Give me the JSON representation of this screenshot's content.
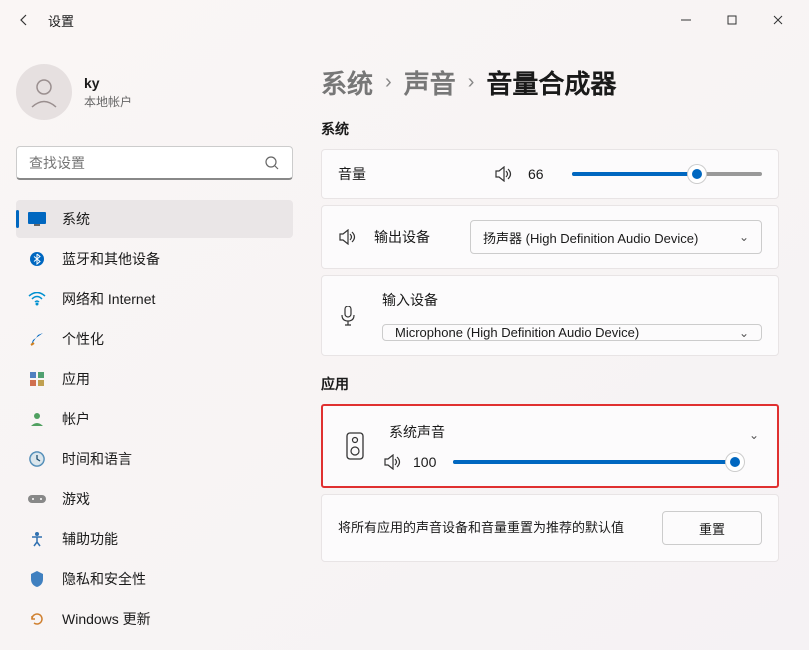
{
  "window": {
    "title": "设置"
  },
  "user": {
    "name": "ky",
    "subtitle": "本地帐户"
  },
  "search": {
    "placeholder": "查找设置"
  },
  "nav": {
    "items": [
      {
        "label": "系统",
        "active": true
      },
      {
        "label": "蓝牙和其他设备",
        "active": false
      },
      {
        "label": "网络和 Internet",
        "active": false
      },
      {
        "label": "个性化",
        "active": false
      },
      {
        "label": "应用",
        "active": false
      },
      {
        "label": "帐户",
        "active": false
      },
      {
        "label": "时间和语言",
        "active": false
      },
      {
        "label": "游戏",
        "active": false
      },
      {
        "label": "辅助功能",
        "active": false
      },
      {
        "label": "隐私和安全性",
        "active": false
      },
      {
        "label": "Windows 更新",
        "active": false
      }
    ]
  },
  "breadcrumb": {
    "system": "系统",
    "sound": "声音",
    "mixer": "音量合成器"
  },
  "system_section": {
    "label": "系统",
    "volume": {
      "label": "音量",
      "value": "66",
      "percent": 66
    },
    "output": {
      "label": "输出设备",
      "selected": "扬声器 (High Definition Audio Device)"
    },
    "input": {
      "label": "输入设备",
      "selected": "Microphone (High Definition Audio Device)"
    }
  },
  "apps_section": {
    "label": "应用",
    "system_sounds": {
      "label": "系统声音",
      "value": "100",
      "percent": 100
    },
    "reset": {
      "text": "将所有应用的声音设备和音量重置为推荐的默认值",
      "button": "重置"
    }
  }
}
